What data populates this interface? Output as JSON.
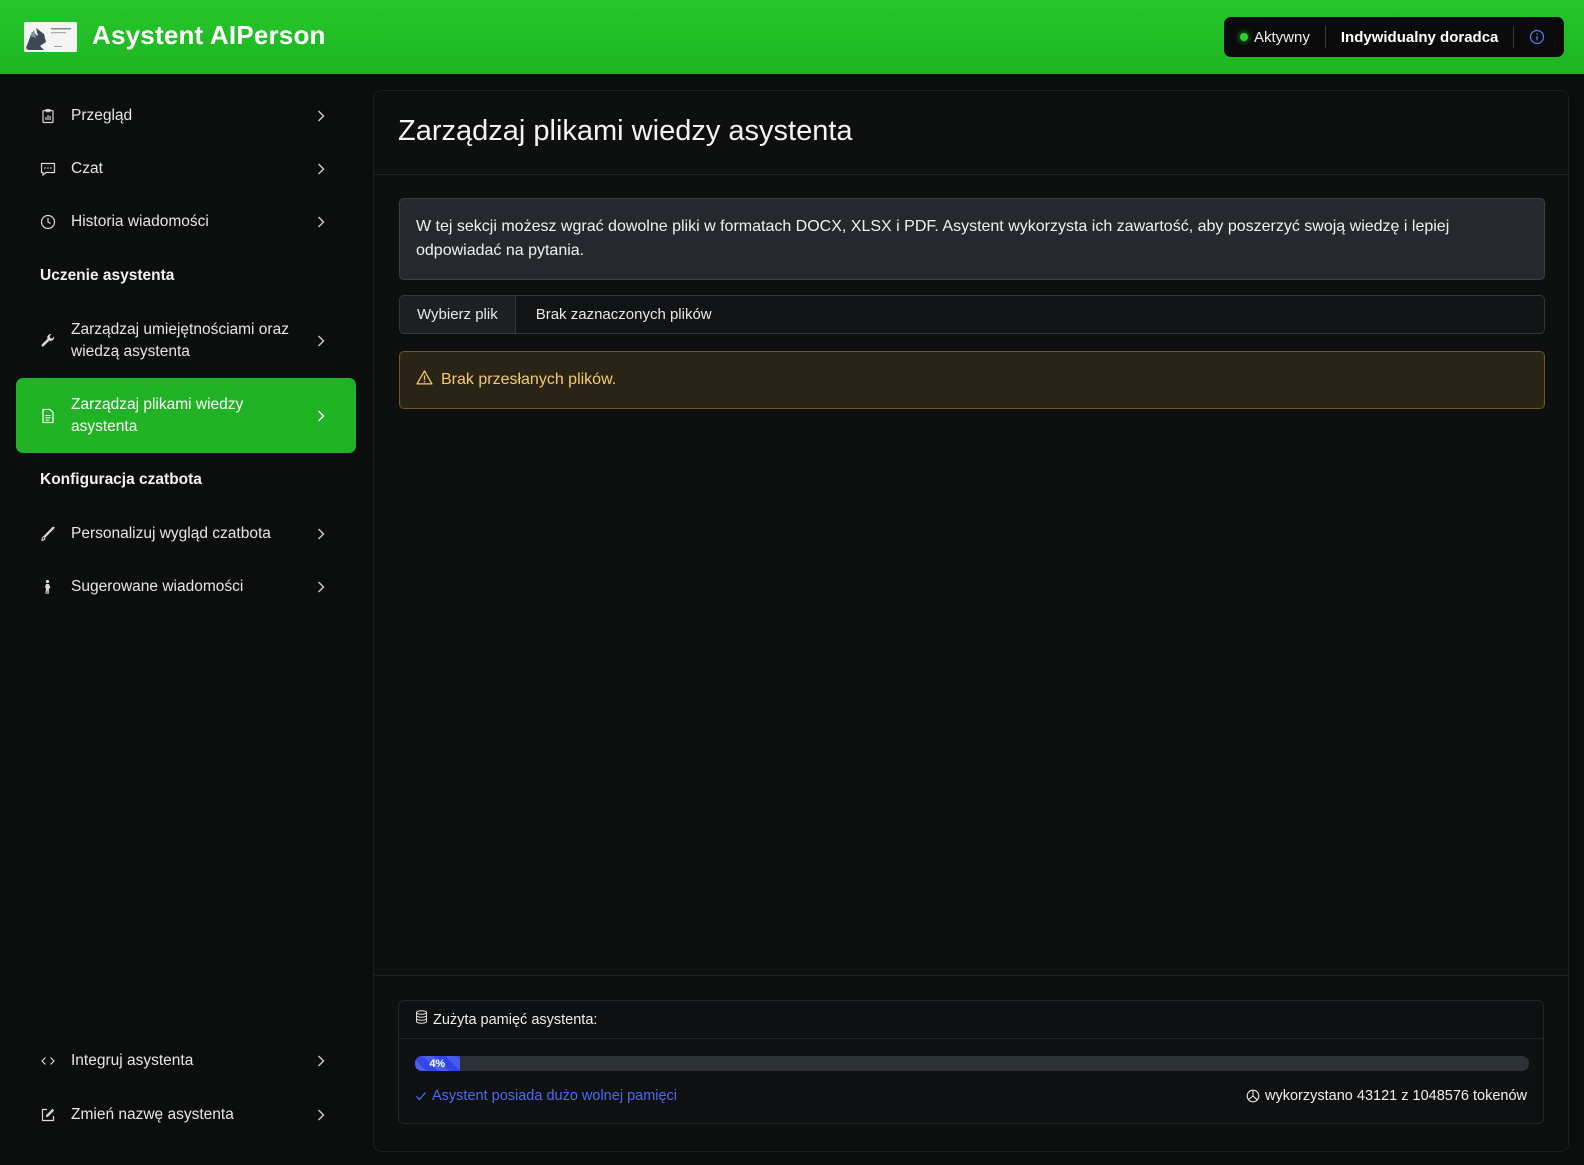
{
  "header": {
    "app_title": "Asystent AIPerson",
    "status": "Aktywny",
    "plan": "Indywidualny doradca",
    "colors": {
      "brand": "#22b226",
      "status_dot": "#2bd131"
    }
  },
  "sidebar": {
    "items_top": [
      {
        "label": "Przegląd",
        "icon": "clipboard-chart-icon"
      },
      {
        "label": "Czat",
        "icon": "chat-bubble-icon"
      },
      {
        "label": "Historia wiadomości",
        "icon": "clock-icon"
      }
    ],
    "section_training": "Uczenie asystenta",
    "items_training": [
      {
        "label": "Zarządzaj umiejętnościami oraz wiedzą asystenta",
        "icon": "wrench-icon"
      },
      {
        "label": "Zarządzaj plikami wiedzy asystenta",
        "icon": "file-text-icon",
        "active": true
      }
    ],
    "section_config": "Konfiguracja czatbota",
    "items_config": [
      {
        "label": "Personalizuj wygląd czatbota",
        "icon": "brush-icon"
      },
      {
        "label": "Sugerowane wiadomości",
        "icon": "person-icon"
      }
    ],
    "items_bottom": [
      {
        "label": "Integruj asystenta",
        "icon": "code-icon"
      },
      {
        "label": "Zmień nazwę asystenta",
        "icon": "edit-square-icon"
      }
    ]
  },
  "main": {
    "title": "Zarządzaj plikami wiedzy asystenta",
    "info_text": "W tej sekcji możesz wgrać dowolne pliki w formatach DOCX, XLSX i PDF. Asystent wykorzysta ich zawartość, aby poszerzyć swoją wiedzę i lepiej odpowiadać na pytania.",
    "file_button": "Wybierz plik",
    "file_placeholder": "Brak zaznaczonych plików",
    "warning": "Brak przesłanych plików."
  },
  "memory": {
    "title": "Zużyta pamięć asystenta:",
    "percent_label": "4%",
    "percent_value": 4,
    "ok_text": "Asystent posiada dużo wolnej pamięci",
    "usage_text": "wykorzystano 43121 z 1048576 tokenów"
  }
}
